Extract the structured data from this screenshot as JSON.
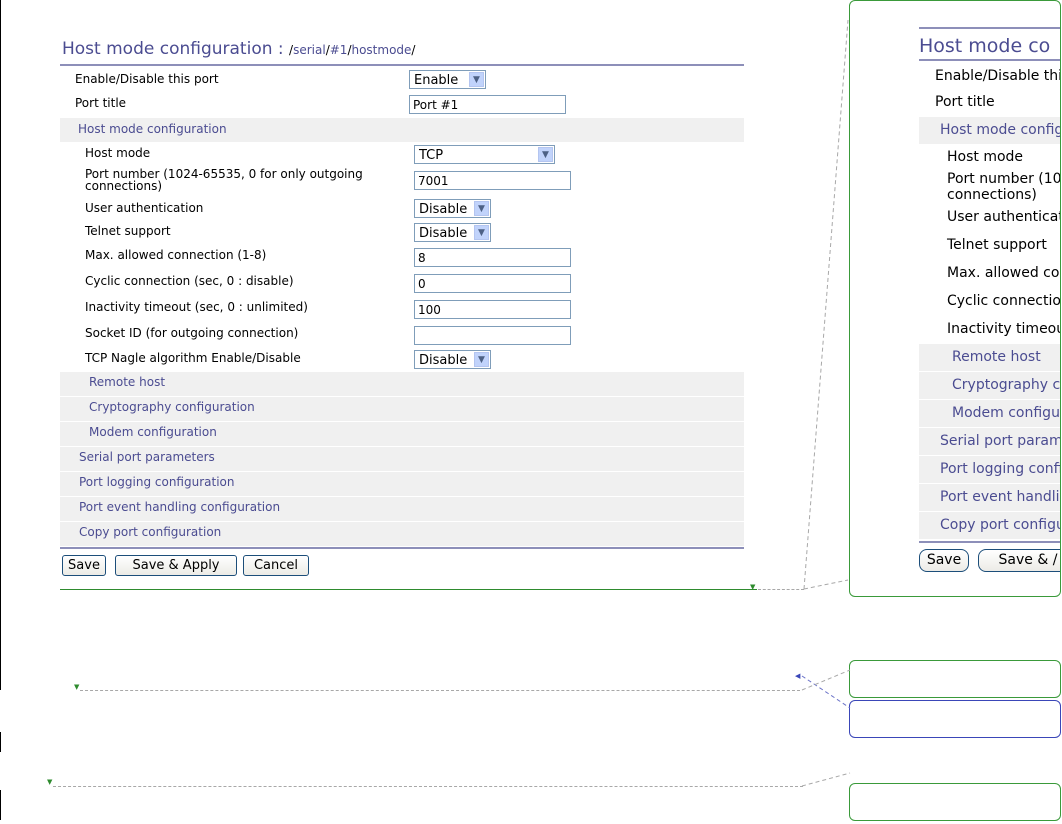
{
  "page": {
    "title": "Host mode configuration",
    "title_sep": " : ",
    "path": {
      "s1": "/",
      "serial": "serial",
      "s2": "/",
      "port": "#1",
      "s3": "/",
      "hostmode": "hostmode",
      "s4": "/"
    }
  },
  "form": {
    "enable_port": {
      "label": "Enable/Disable this port",
      "value": "Enable"
    },
    "port_title": {
      "label": "Port title",
      "value": "Port #1"
    },
    "host_mode_section": "Host mode configuration",
    "host_mode": {
      "label": "Host mode",
      "value": "TCP"
    },
    "port_number": {
      "label_line1": "Port number (1024-65535, 0 for only outgoing",
      "label_line2": "connections)",
      "value": "7001"
    },
    "user_auth": {
      "label": "User authentication",
      "value": "Disable"
    },
    "telnet": {
      "label": "Telnet support",
      "value": "Disable"
    },
    "max_conn": {
      "label": "Max. allowed connection (1-8)",
      "value": "8"
    },
    "cyclic": {
      "label": "Cyclic connection (sec, 0 : disable)",
      "value": "0"
    },
    "inactivity": {
      "label": "Inactivity timeout (sec, 0 : unlimited)",
      "value": "100"
    },
    "socket_id": {
      "label": "Socket ID (for outgoing connection)",
      "value": ""
    },
    "nagle": {
      "label": "TCP Nagle algorithm Enable/Disable",
      "value": "Disable"
    },
    "remote_host": "Remote host",
    "crypto": "Cryptography configuration",
    "modem": "Modem configuration",
    "serial_params": "Serial port parameters",
    "logging": "Port logging configuration",
    "event": "Port event handling configuration",
    "copy": "Copy port configuration"
  },
  "buttons": {
    "save": "Save",
    "save_apply": "Save & Apply",
    "cancel": "Cancel"
  },
  "preview": {
    "title": "Host mode co",
    "enable": "Enable/Disable thi",
    "port_title": "Port title",
    "host_section": "Host mode config",
    "host_mode": "Host mode",
    "port_number_1": "Port number (102",
    "port_number_2": "connections)",
    "user_auth": "User authenticati",
    "telnet": "Telnet support",
    "max_conn": "Max. allowed co",
    "cyclic": "Cyclic connectio",
    "inactivity": "Inactivity timeout",
    "remote_host": "Remote host",
    "crypto": "Cryptography cc",
    "modem": "Modem configur",
    "serial": "Serial port parame",
    "logging": "Port logging confi",
    "event": "Port event handlin",
    "copy": "Copy port configu",
    "save": "Save",
    "save_apply": "Save & /"
  },
  "colors": {
    "accent": "#4b4c91",
    "band": "#f0f0f0",
    "green": "#2e8b2e",
    "blue": "#3a46b8"
  },
  "icons": {
    "dropdown": "chevron-down-icon",
    "marker": "triangle-marker-icon"
  }
}
